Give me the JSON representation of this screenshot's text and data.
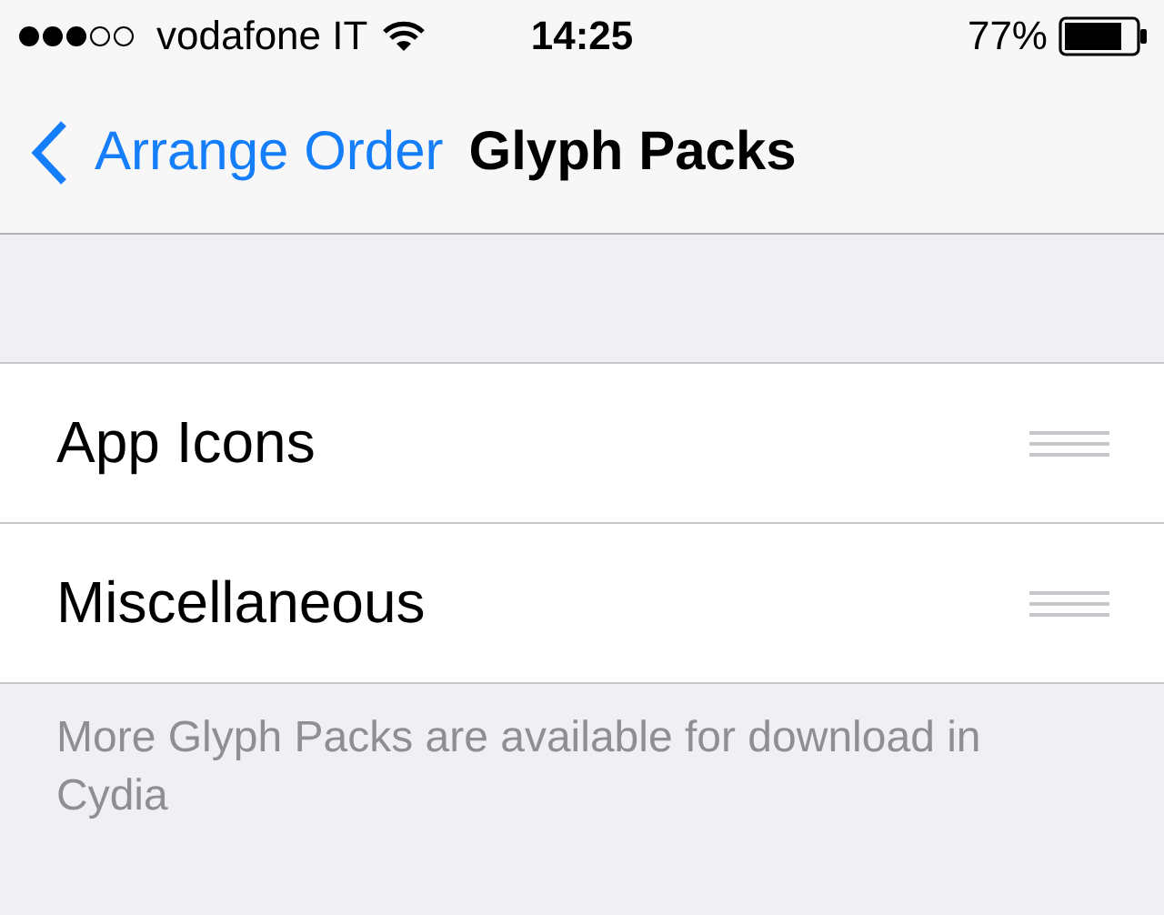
{
  "status_bar": {
    "carrier": "vodafone IT",
    "time": "14:25",
    "battery": "77%"
  },
  "nav": {
    "back": "Arrange Order",
    "title": "Glyph Packs"
  },
  "rows": [
    {
      "label": "App Icons"
    },
    {
      "label": "Miscellaneous"
    }
  ],
  "footer": "More Glyph Packs are available for download in Cydia"
}
